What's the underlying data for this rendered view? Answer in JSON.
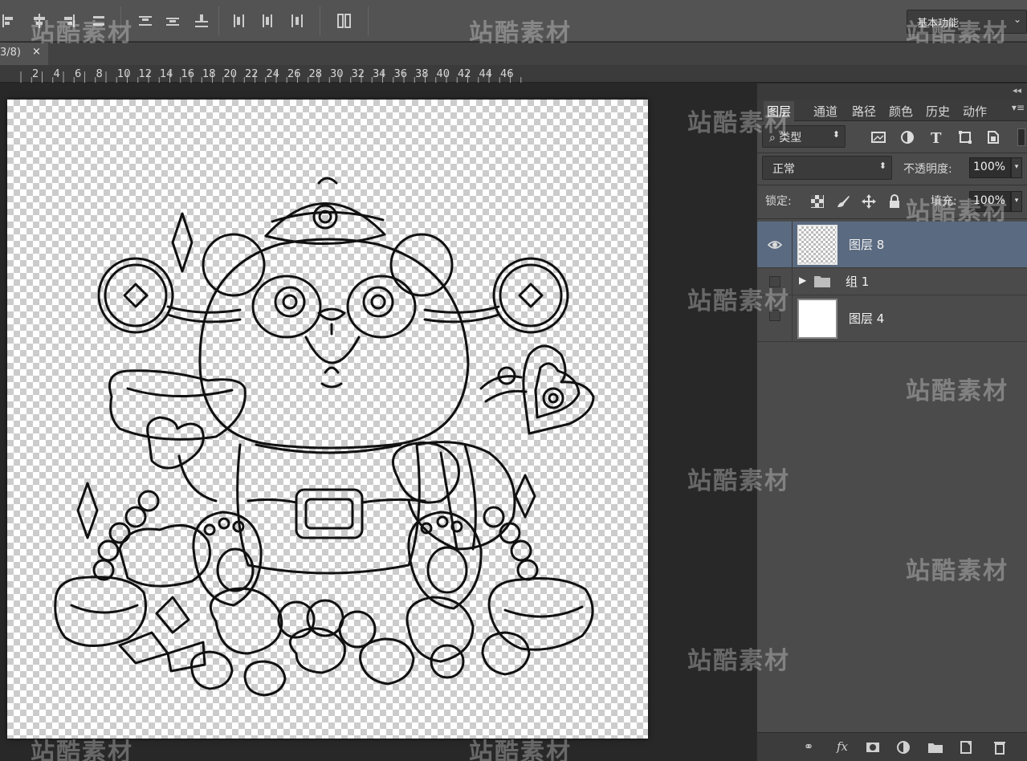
{
  "toolbar": {
    "workspace": "基本功能",
    "icons": [
      "align-left-icon",
      "align-hcenter-icon",
      "align-right-icon",
      "distribute-top-icon",
      "distribute-vcenter-icon",
      "distribute-bottom-icon",
      "distribute-left-icon",
      "distribute-hcenter-icon",
      "distribute-right-icon",
      "auto-align-icon"
    ]
  },
  "document": {
    "tab_label": "3/8)",
    "close": "×"
  },
  "ruler": {
    "ticks": [
      "2",
      "4",
      "6",
      "8",
      "10",
      "12",
      "14",
      "16",
      "18",
      "20",
      "22",
      "24",
      "26",
      "28",
      "30",
      "32",
      "34",
      "36",
      "38",
      "40",
      "42",
      "44",
      "46"
    ]
  },
  "panel": {
    "collapse": "◂◂",
    "tabs": [
      "图层",
      "通道",
      "路径",
      "颜色",
      "历史",
      "动作"
    ],
    "active_tab": "图层",
    "kind_filter": "类型",
    "blend_mode": "正常",
    "opacity_label": "不透明度:",
    "opacity_value": "100%",
    "lock_label": "锁定:",
    "fill_label": "填充:",
    "fill_value": "100%",
    "layers": [
      {
        "name": "图层 8",
        "visible": true,
        "selected": true,
        "thumb": "transparent-lineart"
      },
      {
        "name": "组 1",
        "visible": false,
        "selected": false,
        "type": "group"
      },
      {
        "name": "图层 4",
        "visible": false,
        "selected": false,
        "thumb": "white"
      }
    ]
  },
  "watermark": "站酷素材",
  "colors": {
    "panel_bg": "#4b4b4b",
    "selected_layer": "#5a6a80",
    "app_bg": "#282828"
  }
}
